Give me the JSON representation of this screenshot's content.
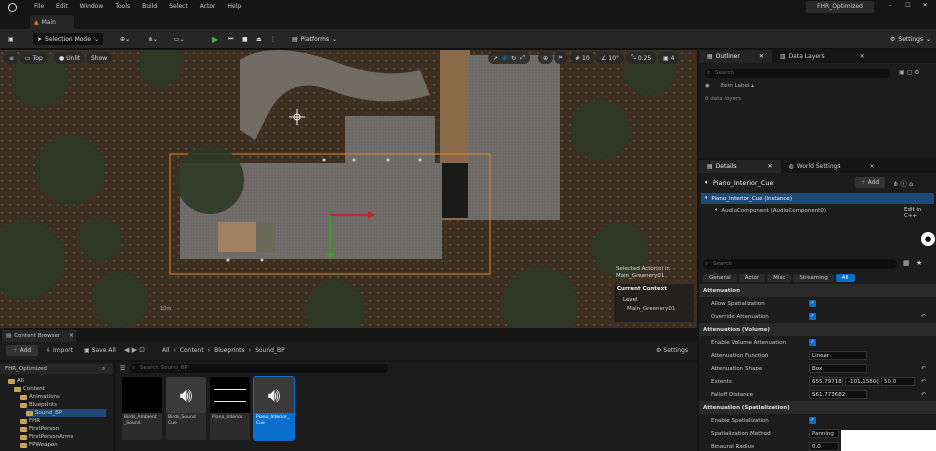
{
  "menu": {
    "items": [
      "File",
      "Edit",
      "Window",
      "Tools",
      "Build",
      "Select",
      "Actor",
      "Help"
    ],
    "project_title": "FHR_Optimized"
  },
  "tabs": {
    "main_tab": "Main"
  },
  "toolbar": {
    "selection_mode": "Selection Mode",
    "platforms": "Platforms",
    "settings": "Settings"
  },
  "viewport": {
    "view_mode": "Top",
    "lit_mode": "Unlit",
    "show": "Show",
    "grid_value": "10",
    "rotation_value": "10°",
    "scale_value": "0.25",
    "camera_speed": "4",
    "selected_text": "Selected Actor(s) in",
    "selected_level": "Main_Greenery01",
    "current_context": "Current Context",
    "level_label": "Level",
    "level_value": "Main_Greenery01",
    "scale_text": "10m"
  },
  "outliner": {
    "tab1": "Outliner",
    "tab2": "Data Layers",
    "search_placeholder": "Search",
    "column": "Item Label",
    "status": "0 data layers"
  },
  "details": {
    "tab1": "Details",
    "tab2": "World Settings",
    "actor_name": "Piano_Interior_Cue",
    "add_label": "Add",
    "component_instance": "Piano_Interior_Cue (Instance)",
    "component_child": "AudioComponent (AudioComponent0)",
    "edit_cpp": "Edit in C++",
    "search_placeholder": "Search",
    "filters": [
      "General",
      "Actor",
      "Misc",
      "Streaming",
      "All"
    ],
    "rows": {
      "cat_attenuation": "Attenuation",
      "allow_spatialization": "Allow Spatialization",
      "override_attenuation": "Override Attenuation",
      "cat_attenuation_volume": "Attenuation (Volume)",
      "enable_volume_attenuation": "Enable Volume Attenuation",
      "attenuation_function": "Attenuation Function",
      "attenuation_function_value": "Linear",
      "attenuation_shape": "Attenuation Shape",
      "attenuation_shape_value": "Box",
      "extents": "Extents",
      "extents_x": "655.79718",
      "extents_y": "-101.1580(",
      "extents_z": "50.0",
      "falloff_distance": "Falloff Distance",
      "falloff_value": "561.773682",
      "cat_attenuation_spatialization": "Attenuation (Spatialization)",
      "enable_spatialization": "Enable Spatialization",
      "spatialization_method": "Spatialization Method",
      "spatialization_method_value": "Panning",
      "binaural_radius": "Binaural Radius",
      "binaural_value": "0.0"
    }
  },
  "content_browser": {
    "tab": "Content Browser",
    "add": "Add",
    "import": "Import",
    "save_all": "Save All",
    "breadcrumb": [
      "All",
      "Content",
      "Blueprints",
      "Sound_BP"
    ],
    "settings": "Settings",
    "search_placeholder": "Search Sound_BP",
    "tree": [
      "FHR_Optimized",
      "All",
      "Content",
      "Animations",
      "Blueprints",
      "Sound_BP",
      "FHR",
      "FirstPerson",
      "FirstPersonArms",
      "FPWeapon"
    ],
    "assets": [
      {
        "name": "Birds_Ambient\n_Sound"
      },
      {
        "name": "Birds_Sound\nCue"
      },
      {
        "name": "Piano_Interior"
      },
      {
        "name": "Piano_Interior_\nCue"
      }
    ]
  },
  "colors": {
    "accent": "#0a6ecc",
    "add_green": "#3a8a3a",
    "selection_orange": "#e08a1e"
  }
}
